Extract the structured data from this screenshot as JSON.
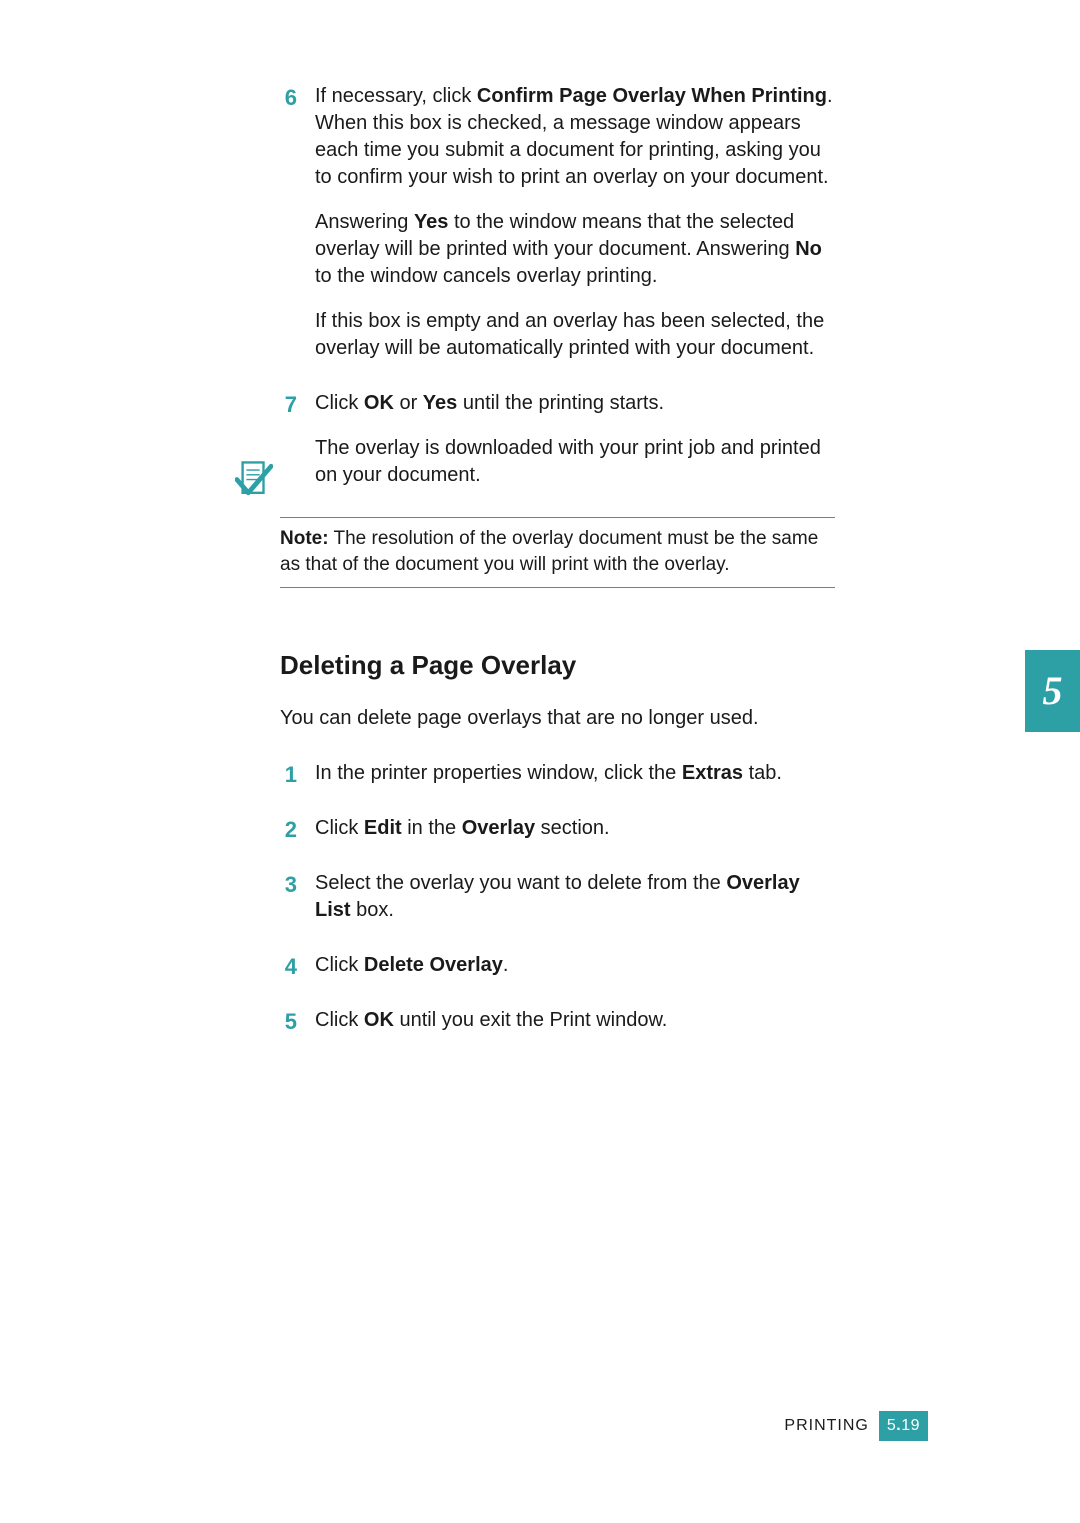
{
  "colors": {
    "accent": "#2CA0A5"
  },
  "steps_a": [
    {
      "num": "6",
      "paras": [
        "If necessary, click <b>Confirm Page Overlay When Printing</b>. When this box is checked, a message window appears each time you submit a document for printing, asking you to confirm your wish to print an overlay on your document.",
        "Answering <b>Yes</b> to the window means that the selected overlay will be printed with your document. Answering <b>No</b> to the window cancels overlay printing.",
        "If this box is empty and an overlay has been selected, the overlay will be automatically printed with your document."
      ]
    },
    {
      "num": "7",
      "paras": [
        "Click <b>OK</b> or <b>Yes</b> until the printing starts.",
        "The overlay is downloaded with your print job and printed on your document."
      ]
    }
  ],
  "note": {
    "label": "Note:",
    "text": "The resolution of the overlay document must be the same as that of the document you will print with the overlay."
  },
  "section": {
    "heading": "Deleting a Page Overlay",
    "intro": "You can delete page overlays that are no longer used.",
    "steps": [
      {
        "num": "1",
        "paras": [
          "In the printer properties window, click the <b>Extras</b> tab."
        ]
      },
      {
        "num": "2",
        "paras": [
          "Click <b>Edit</b> in the <b>Overlay</b> section."
        ]
      },
      {
        "num": "3",
        "paras": [
          "Select the overlay you want to delete from the <b>Overlay List</b> box."
        ]
      },
      {
        "num": "4",
        "paras": [
          "Click <b>Delete Overlay</b>."
        ]
      },
      {
        "num": "5",
        "paras": [
          "Click <b>OK</b> until you exit the Print window."
        ]
      }
    ]
  },
  "chapter_tab": "5",
  "footer": {
    "label": "PRINTING",
    "chapter": "5",
    "dot": ".",
    "page": "19"
  }
}
